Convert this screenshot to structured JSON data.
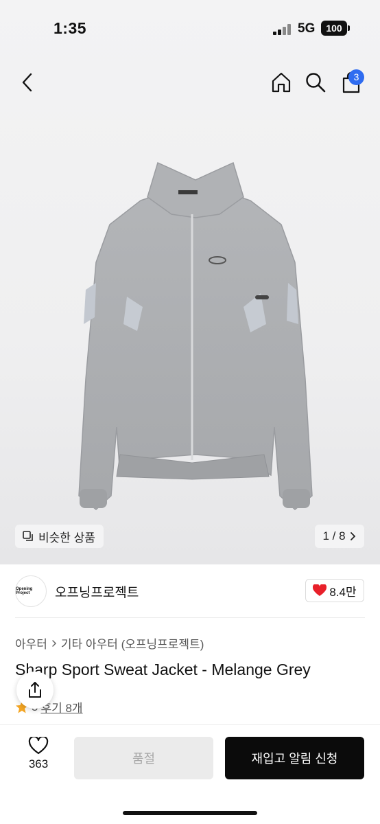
{
  "status_bar": {
    "time": "1:35",
    "network": "5G",
    "battery": "100"
  },
  "nav": {
    "cart_count": "3",
    "icons": [
      "back-chevron-icon",
      "home-icon",
      "search-icon",
      "cart-icon"
    ]
  },
  "gallery": {
    "similar_label": "비슷한 상품",
    "page_indicator": "1 / 8"
  },
  "brand": {
    "logo_text": "Opening Project",
    "name": "오프닝프로젝트",
    "likes": "8.4만"
  },
  "product": {
    "breadcrumb": [
      "아우터",
      "기타 아우터 (오프닝프로젝트)"
    ],
    "title": "Sharp Sport Sweat Jacket - Melange Grey",
    "rating": "5",
    "reviews_label": "후기 8개"
  },
  "bottom_bar": {
    "wish_count": "363",
    "soldout_label": "품절",
    "restock_label": "재입고 알림 신청"
  },
  "colors": {
    "accent": "#2f6cf0",
    "heart": "#e8202a",
    "star": "#f5a623",
    "primary_button": "#0b0b0b"
  }
}
